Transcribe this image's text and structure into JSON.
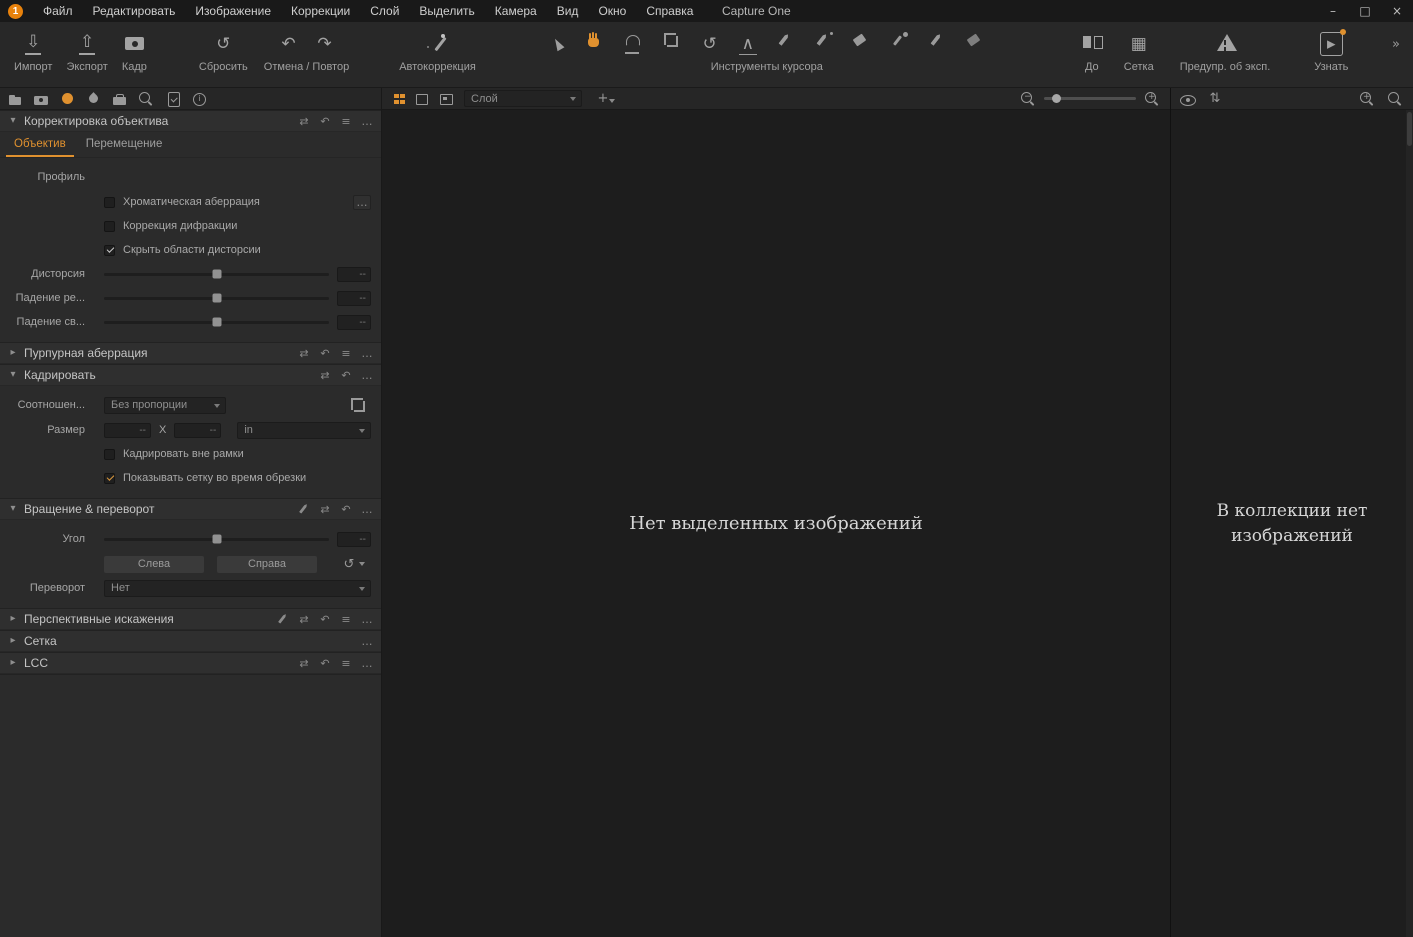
{
  "colors": {
    "accent": "#e0912f",
    "background": "#1e1e1e"
  },
  "menubar": {
    "logo_text": "1",
    "items": [
      "Файл",
      "Редактировать",
      "Изображение",
      "Коррекции",
      "Слой",
      "Выделить",
      "Камера",
      "Вид",
      "Окно",
      "Справка"
    ],
    "window_title": "Capture One"
  },
  "toolbar": {
    "import": "Импорт",
    "export": "Экспорт",
    "frame": "Кадр",
    "reset": "Сбросить",
    "undo_redo": "Отмена / Повтор",
    "autocorrect": "Автокоррекция",
    "cursor_tools": "Инструменты курсора",
    "before": "До",
    "grid": "Сетка",
    "exposure_warning": "Предупр. об эксп.",
    "learn": "Узнать",
    "cursor_tool_items": [
      {
        "name": "pointer"
      },
      {
        "name": "hand",
        "active": true
      },
      {
        "name": "loupe"
      },
      {
        "name": "crop-tool"
      },
      {
        "name": "rotate"
      },
      {
        "name": "straighten"
      },
      {
        "name": "heal-pen"
      },
      {
        "name": "clone-pen"
      },
      {
        "name": "eraser"
      },
      {
        "name": "dropper"
      },
      {
        "name": "mask-pen"
      },
      {
        "name": "mask-eraser"
      }
    ]
  },
  "tool_tabs": [
    {
      "name": "library"
    },
    {
      "name": "capture"
    },
    {
      "name": "lens",
      "active": true
    },
    {
      "name": "color"
    },
    {
      "name": "exposure"
    },
    {
      "name": "details"
    },
    {
      "name": "adjustments"
    },
    {
      "name": "info"
    }
  ],
  "left_panel": {
    "lens": {
      "title": "Корректировка объектива",
      "header_icons": [
        {
          "name": "copy"
        },
        {
          "name": "undo-s"
        },
        {
          "name": "menu"
        },
        {
          "name": "more"
        }
      ],
      "tabs": [
        {
          "label": "Объектив",
          "active": true
        },
        {
          "label": "Перемещение",
          "active": false
        }
      ],
      "profile_label": "Профиль",
      "checkboxes": [
        {
          "label": "Хроматическая аберрация",
          "checked": false
        },
        {
          "label": "Коррекция дифракции",
          "checked": false
        },
        {
          "label": "Скрыть области дисторсии",
          "checked": true
        }
      ],
      "sliders": [
        {
          "label": "Дисторсия",
          "value": "--"
        },
        {
          "label": "Падение ре...",
          "value": "--"
        },
        {
          "label": "Падение св...",
          "value": "--"
        }
      ]
    },
    "purple": {
      "title": "Пурпурная аберрация",
      "header_icons": [
        {
          "name": "copy"
        },
        {
          "name": "undo-s"
        },
        {
          "name": "menu"
        },
        {
          "name": "more"
        }
      ]
    },
    "crop": {
      "title": "Кадрировать",
      "header_icons": [
        {
          "name": "copy"
        },
        {
          "name": "undo-s"
        },
        {
          "name": "more"
        }
      ],
      "ratio_label": "Соотношен...",
      "ratio_value": "Без пропорции",
      "size_label": "Размер",
      "width_value": "--",
      "x_separator": "X",
      "height_value": "--",
      "unit_value": "in",
      "checkboxes": [
        {
          "label": "Кадрировать вне рамки",
          "checked": false
        },
        {
          "label": "Показывать сетку во время обрезки",
          "checked": true
        }
      ]
    },
    "rotation": {
      "title": "Вращение & переворот",
      "header_icons": [
        {
          "name": "pencil"
        },
        {
          "name": "copy"
        },
        {
          "name": "undo-s"
        },
        {
          "name": "more"
        }
      ],
      "angle_label": "Угол",
      "angle_value": "--",
      "left_button": "Слева",
      "right_button": "Справа",
      "flip_label": "Переворот",
      "flip_value": "Нет"
    },
    "keystone": {
      "title": "Перспективные искажения",
      "header_icons": [
        {
          "name": "pencil"
        },
        {
          "name": "copy"
        },
        {
          "name": "undo-s"
        },
        {
          "name": "menu"
        },
        {
          "name": "more"
        }
      ]
    },
    "grid": {
      "title": "Сетка",
      "header_icons": [
        {
          "name": "more"
        }
      ]
    },
    "lcc": {
      "title": "LCC",
      "header_icons": [
        {
          "name": "copy"
        },
        {
          "name": "undo-s"
        },
        {
          "name": "menu"
        },
        {
          "name": "more"
        }
      ]
    }
  },
  "viewer": {
    "layer_dropdown": "Слой",
    "empty_message": "Нет выделенных изображений"
  },
  "browser": {
    "empty_message": "В коллекции нет изображений"
  },
  "icons": {
    "minimize": "–",
    "maximize": "□",
    "close": "×",
    "import": "⇩",
    "export": "⇧",
    "reset": "↺",
    "undo": "↶",
    "redo": "↷",
    "rotate": "↺",
    "straighten": "∧",
    "copy": "⇄",
    "undo-s": "↶",
    "menu": "≡",
    "more": "…",
    "chevron-down": "▾",
    "chevron-right": "▸",
    "grid-table": "▦",
    "overflow": "»",
    "learn": "▸",
    "info": "i",
    "plus-layer": "+",
    "sort": "⇅",
    "mag-minus": "−",
    "mag-plus": "+"
  }
}
